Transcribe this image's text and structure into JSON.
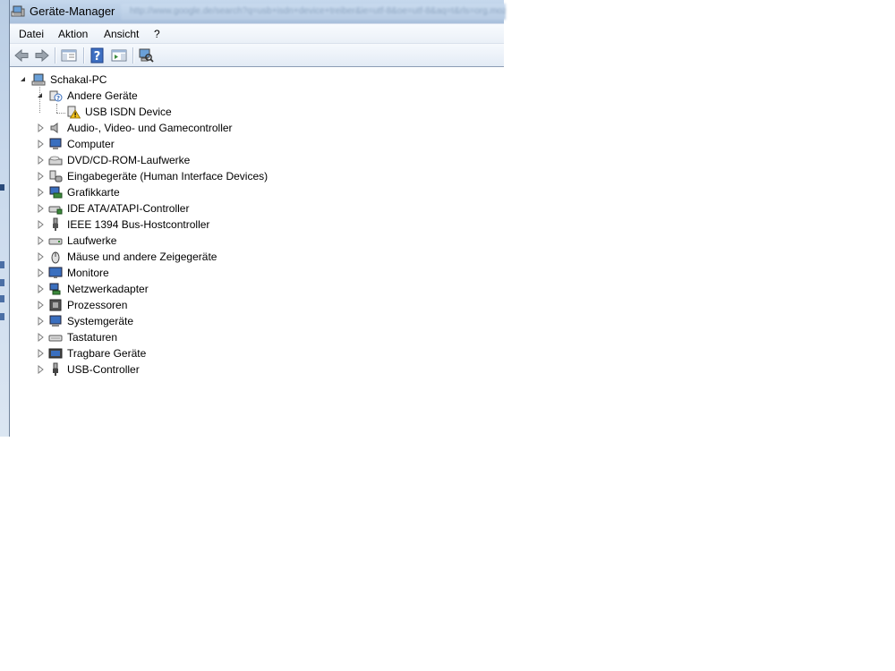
{
  "window": {
    "title": "Geräte-Manager",
    "title_bar_url": "http://www.google.de/search?q=usb+isdn+device+treiber&ie=utf-8&oe=utf-8&aq=t&rls=org.mozilla"
  },
  "menubar": {
    "items": [
      "Datei",
      "Aktion",
      "Ansicht",
      "?"
    ]
  },
  "toolbar": {
    "buttons": [
      "back-arrow-icon",
      "forward-arrow-icon",
      "show-hide-console-tree-icon",
      "help-icon",
      "action-pane-icon",
      "scan-hardware-icon"
    ]
  },
  "tree": {
    "root": {
      "label": "Schakal-PC",
      "expanded": true,
      "icon": "computer-icon"
    },
    "andere_geraete": {
      "label": "Andere Geräte",
      "expanded": true,
      "icon": "unknown-device-icon"
    },
    "usb_isdn": {
      "label": "USB ISDN Device",
      "icon": "warning-device-icon"
    },
    "categories": [
      {
        "label": "Audio-, Video- und Gamecontroller",
        "icon": "speaker-icon"
      },
      {
        "label": "Computer",
        "icon": "computer-monitor-icon"
      },
      {
        "label": "DVD/CD-ROM-Laufwerke",
        "icon": "optical-drive-icon"
      },
      {
        "label": "Eingabegeräte (Human Interface Devices)",
        "icon": "hid-icon"
      },
      {
        "label": "Grafikkarte",
        "icon": "display-adapter-icon"
      },
      {
        "label": "IDE ATA/ATAPI-Controller",
        "icon": "ide-controller-icon"
      },
      {
        "label": "IEEE 1394 Bus-Hostcontroller",
        "icon": "firewire-icon"
      },
      {
        "label": "Laufwerke",
        "icon": "disk-drive-icon"
      },
      {
        "label": "Mäuse und andere Zeigegeräte",
        "icon": "mouse-icon"
      },
      {
        "label": "Monitore",
        "icon": "monitor-icon"
      },
      {
        "label": "Netzwerkadapter",
        "icon": "network-adapter-icon"
      },
      {
        "label": "Prozessoren",
        "icon": "processor-icon"
      },
      {
        "label": "Systemgeräte",
        "icon": "system-devices-icon"
      },
      {
        "label": "Tastaturen",
        "icon": "keyboard-icon"
      },
      {
        "label": "Tragbare Geräte",
        "icon": "portable-device-icon"
      },
      {
        "label": "USB-Controller",
        "icon": "usb-icon"
      }
    ]
  }
}
